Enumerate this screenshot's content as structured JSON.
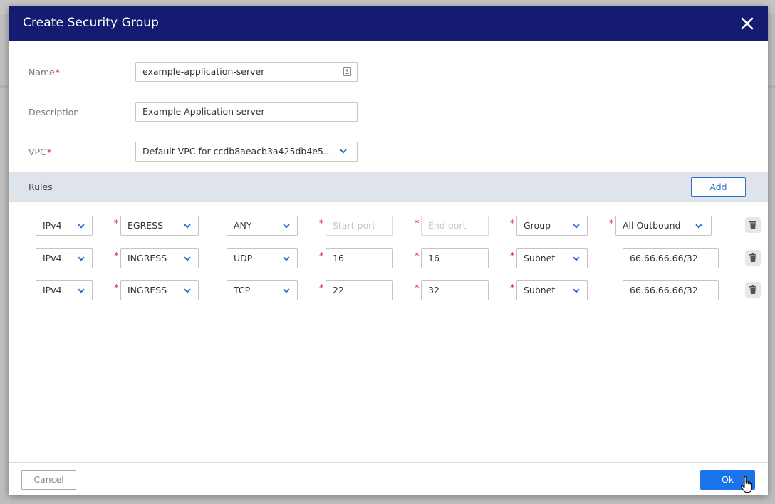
{
  "dialog": {
    "title": "Create Security Group",
    "close_icon": "close-icon"
  },
  "form": {
    "name": {
      "label": "Name",
      "required": "*",
      "value": "example-application-server",
      "icon": "contact-card-icon"
    },
    "description": {
      "label": "Description",
      "value": "Example Application server"
    },
    "vpc": {
      "label": "VPC",
      "required": "*",
      "value": "Default VPC for ccdb8aeacb3a425db4e54..."
    }
  },
  "rules": {
    "label": "Rules",
    "add_label": "Add",
    "required_mark": "*",
    "rows": [
      {
        "ip": "IPv4",
        "direction": "EGRESS",
        "protocol": "ANY",
        "start_port": "",
        "start_placeholder": "Start port",
        "end_port": "",
        "end_placeholder": "End port",
        "target_type": "Group",
        "target": "All Outbound"
      },
      {
        "ip": "IPv4",
        "direction": "INGRESS",
        "protocol": "UDP",
        "start_port": "16",
        "start_placeholder": "Start port",
        "end_port": "16",
        "end_placeholder": "End port",
        "target_type": "Subnet",
        "target": "66.66.66.66/32"
      },
      {
        "ip": "IPv4",
        "direction": "INGRESS",
        "protocol": "TCP",
        "start_port": "22",
        "start_placeholder": "Start port",
        "end_port": "32",
        "end_placeholder": "End port",
        "target_type": "Subnet",
        "target": "66.66.66.66/32"
      }
    ]
  },
  "footer": {
    "cancel_label": "Cancel",
    "ok_label": "Ok"
  },
  "colors": {
    "header_bg": "#141b70",
    "accent": "#1a73e8",
    "required": "#e0271f"
  }
}
